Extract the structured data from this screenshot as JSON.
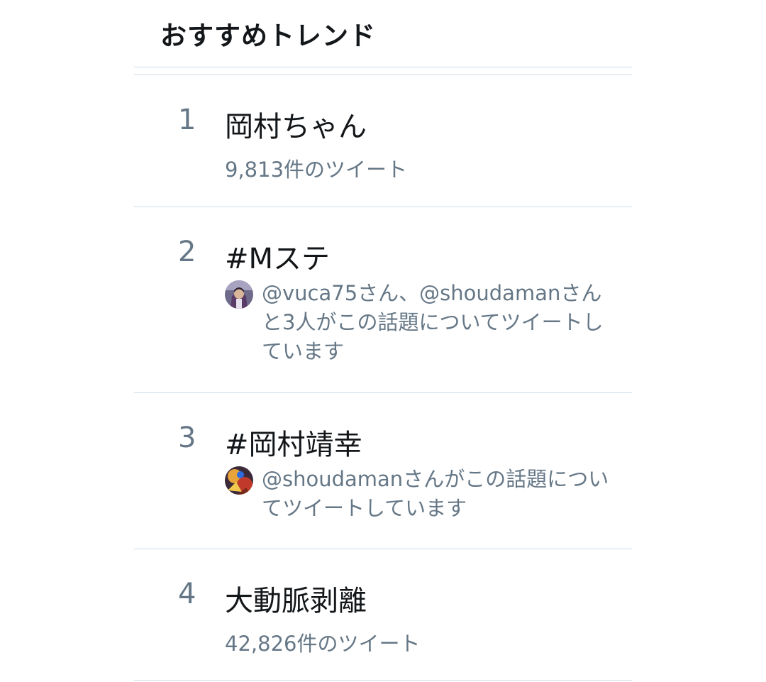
{
  "header": {
    "title": "おすすめトレンド"
  },
  "trends": [
    {
      "rank": "1",
      "name": "岡村ちゃん",
      "meta": "9,813件のツイート"
    },
    {
      "rank": "2",
      "name": "#Mステ",
      "context": "@vuca75さん、@shoudamanさんと3人がこの話題についてツイートしています",
      "avatar_icon": "user-avatar-icon"
    },
    {
      "rank": "3",
      "name": "#岡村靖幸",
      "context": "@shoudamanさんがこの話題についてツイートしています",
      "avatar_icon": "user-avatar-icon"
    },
    {
      "rank": "4",
      "name": "大動脈剥離",
      "meta": "42,826件のツイート"
    }
  ],
  "colors": {
    "primary_text": "#14171a",
    "secondary_text": "#657786",
    "divider": "#cfdde6"
  }
}
